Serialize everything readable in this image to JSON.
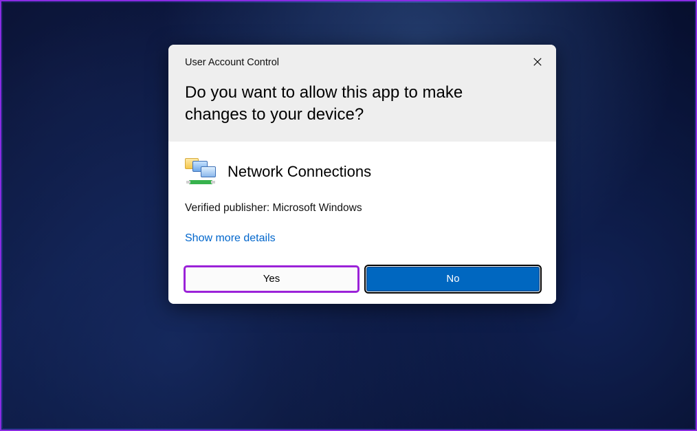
{
  "dialog": {
    "title": "User Account Control",
    "question": "Do you want to allow this app to make changes to your device?",
    "app_name": "Network Connections",
    "publisher_line": "Verified publisher: Microsoft Windows",
    "details_link": "Show more details",
    "buttons": {
      "yes": "Yes",
      "no": "No"
    },
    "icons": {
      "close": "close-icon",
      "app": "network-connections-icon"
    },
    "colors": {
      "accent_blue": "#0067c0",
      "link_blue": "#0066cc",
      "highlight_purple": "#9b22d8"
    }
  }
}
